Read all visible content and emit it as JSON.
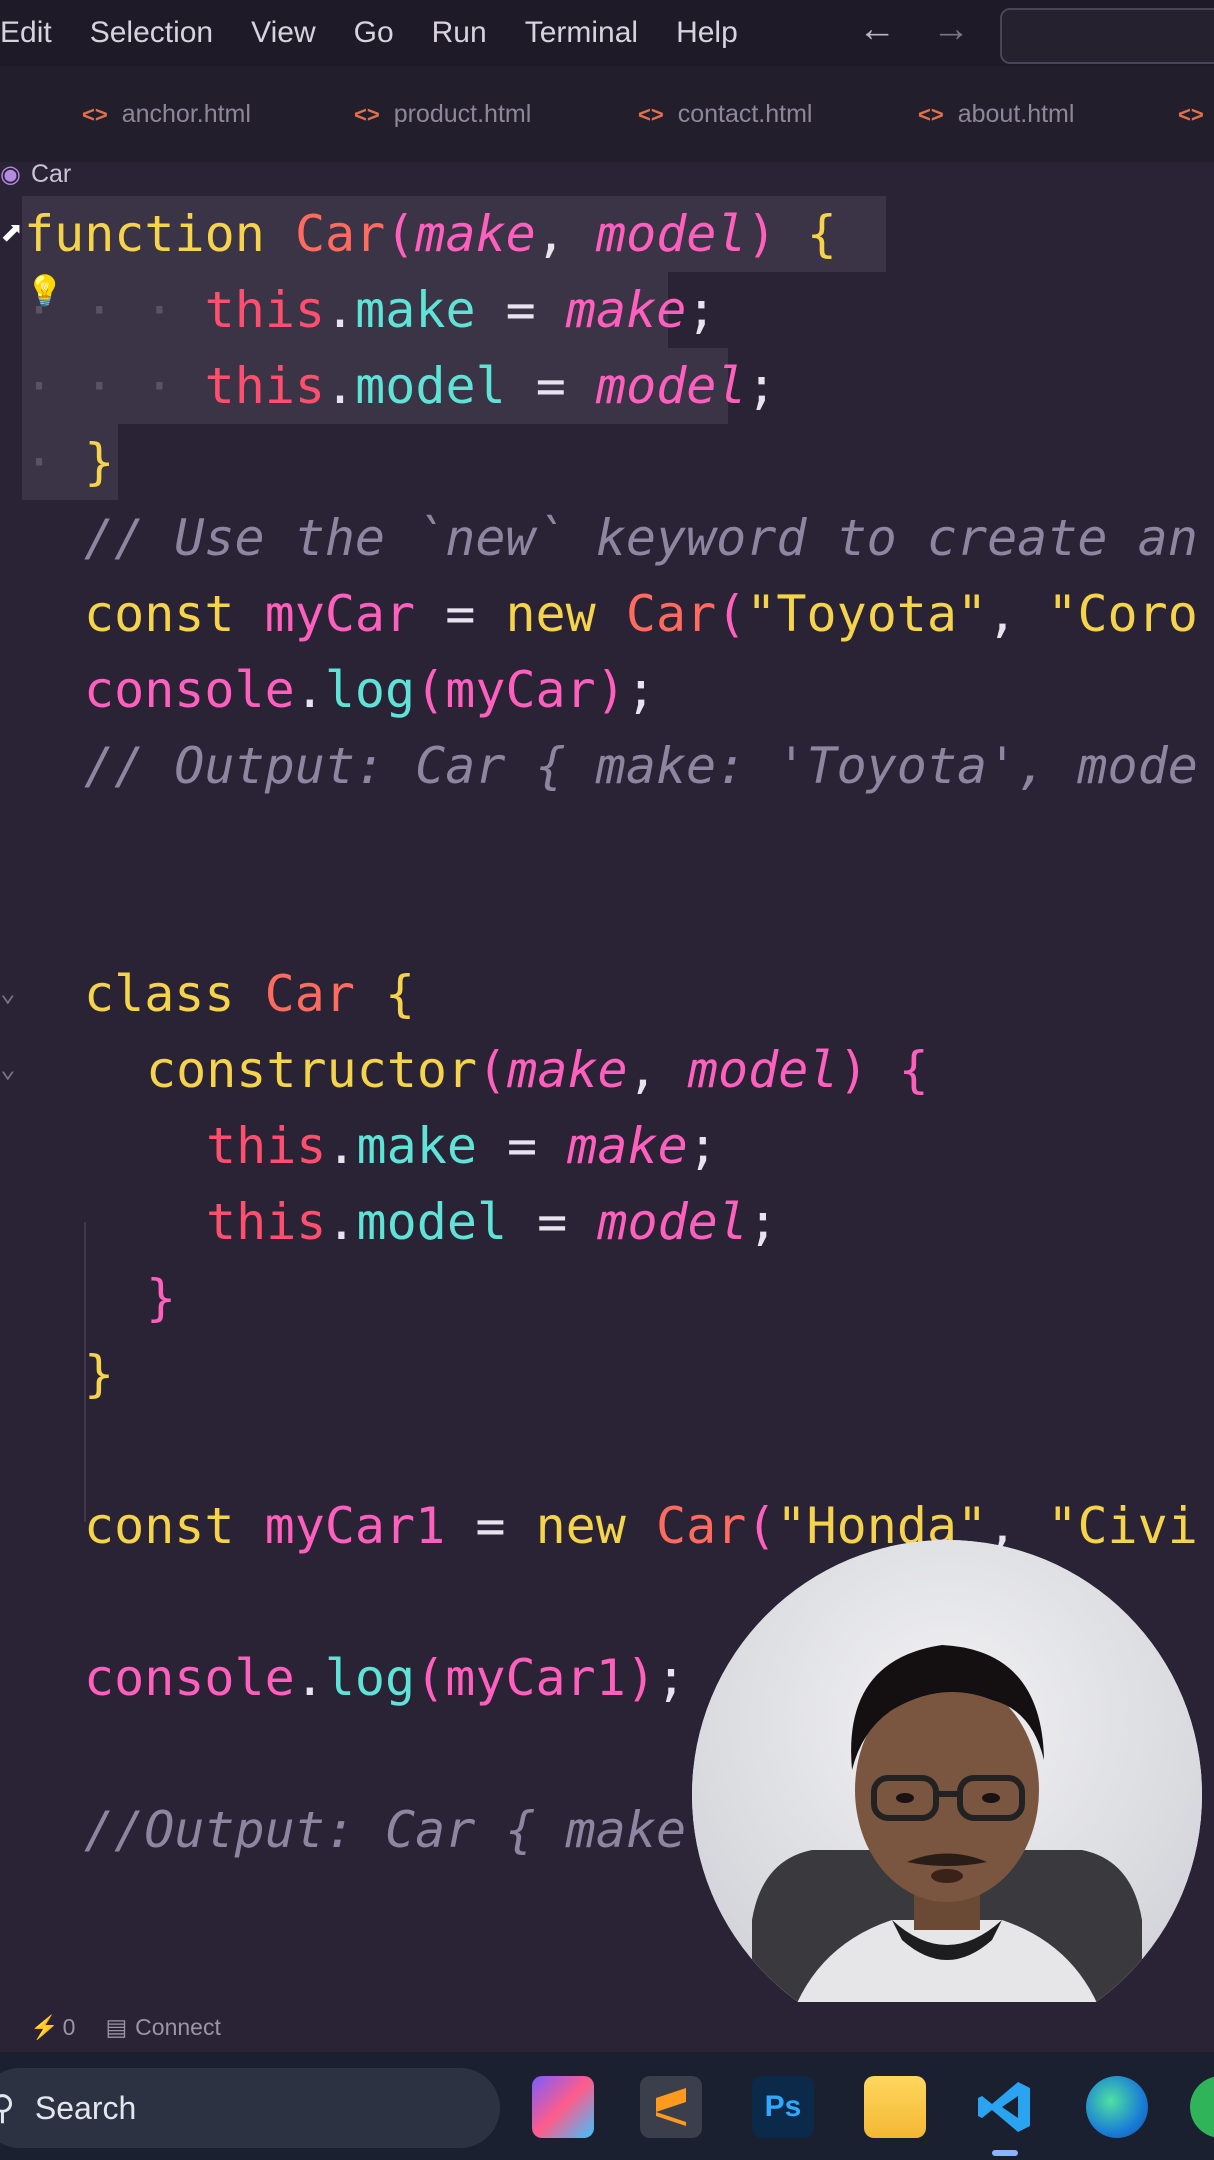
{
  "menu": {
    "items": [
      "Edit",
      "Selection",
      "View",
      "Go",
      "Run",
      "Terminal",
      "Help"
    ]
  },
  "tabs": [
    {
      "label": "anchor.html"
    },
    {
      "label": "product.html"
    },
    {
      "label": "contact.html"
    },
    {
      "label": "about.html"
    }
  ],
  "breadcrumb": {
    "label": "Car"
  },
  "code": {
    "fn_keyword": "function",
    "class_name": "Car",
    "param_make": "make",
    "param_model": "model",
    "this_kw": "this",
    "prop_make": "make",
    "prop_model": "model",
    "comment1": "// Use the `new` keyword to create an",
    "const_kw": "const",
    "var_mycar": "myCar",
    "new_kw": "new",
    "str_toyota": "\"Toyota\"",
    "str_corolla": "\"Coro",
    "console": "console",
    "log": "log",
    "comment2": "// Output: Car { make: 'Toyota', mode",
    "class_kw": "class",
    "constructor_kw": "constructor",
    "var_mycar1": "myCar1",
    "str_honda": "\"Honda\"",
    "str_civic": "\"Civi",
    "comment3": "//Output: Car { make"
  },
  "status": {
    "ports": "0",
    "connect": "Connect"
  },
  "taskbar": {
    "search": "Search"
  },
  "colors": {
    "keyword": "#f5d44b",
    "function_name": "#ff6b5e",
    "parameter": "#ff5fbd",
    "this": "#ff4f6e",
    "property": "#5ee3d6",
    "comment": "#8d86a0"
  }
}
